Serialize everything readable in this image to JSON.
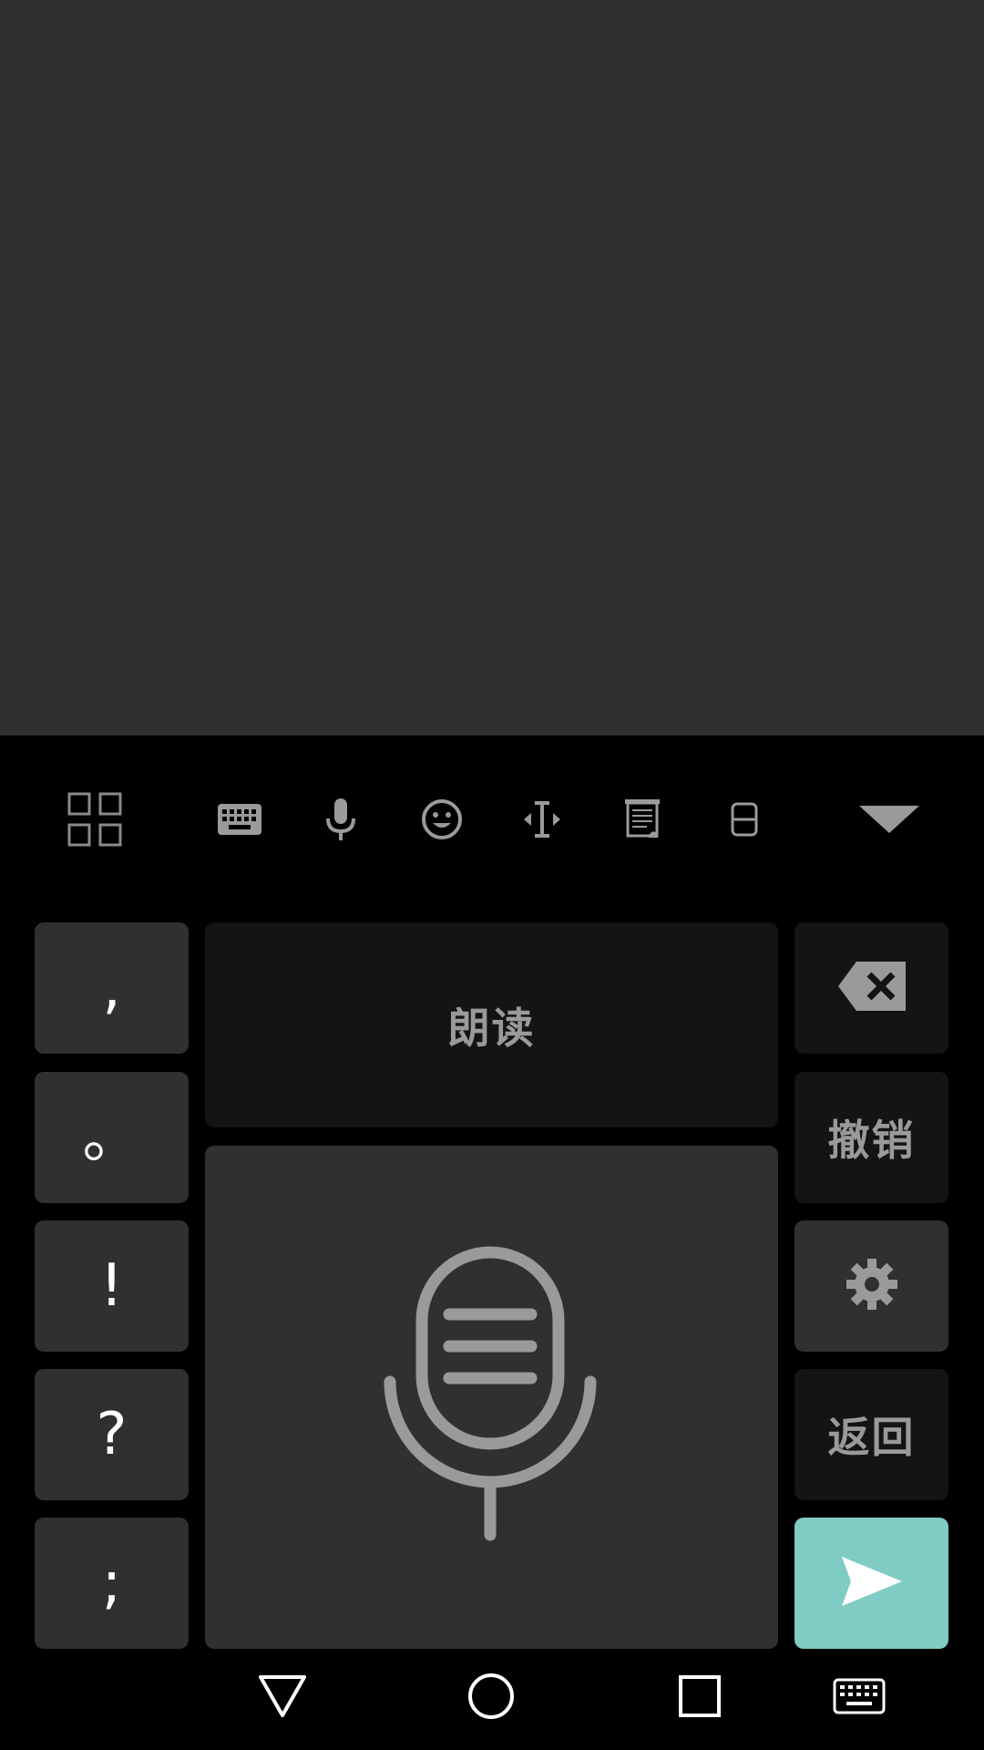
{
  "toolbar": {
    "icons": [
      "apps-grid-icon",
      "keyboard-icon",
      "microphone-icon",
      "emoji-icon",
      "cursor-move-icon",
      "clipboard-icon",
      "one-handed-icon",
      "collapse-triangle-icon"
    ]
  },
  "punctuation_keys": [
    {
      "label": ",",
      "name": "comma-key"
    },
    {
      "label": "。",
      "name": "period-key"
    },
    {
      "label": "!",
      "name": "exclamation-key"
    },
    {
      "label": "?",
      "name": "question-key"
    },
    {
      "label": ";",
      "name": "semicolon-key"
    }
  ],
  "center": {
    "read_aloud_label": "朗读",
    "voice_icon": "voice-microphone-icon"
  },
  "right_keys": {
    "backspace_icon": "backspace-icon",
    "undo_label": "撤销",
    "settings_icon": "gear-icon",
    "back_label": "返回",
    "send_icon": "send-icon"
  },
  "navbar": {
    "icons": [
      "back-triangle-icon",
      "home-circle-icon",
      "recents-square-icon",
      "keyboard-switch-icon"
    ]
  },
  "colors": {
    "app_background": "#303030",
    "keyboard_background": "#000000",
    "key_light": "#303030",
    "key_dark": "#141414",
    "send_accent": "#80cbc4",
    "icon_gray": "#9a9a9a"
  }
}
